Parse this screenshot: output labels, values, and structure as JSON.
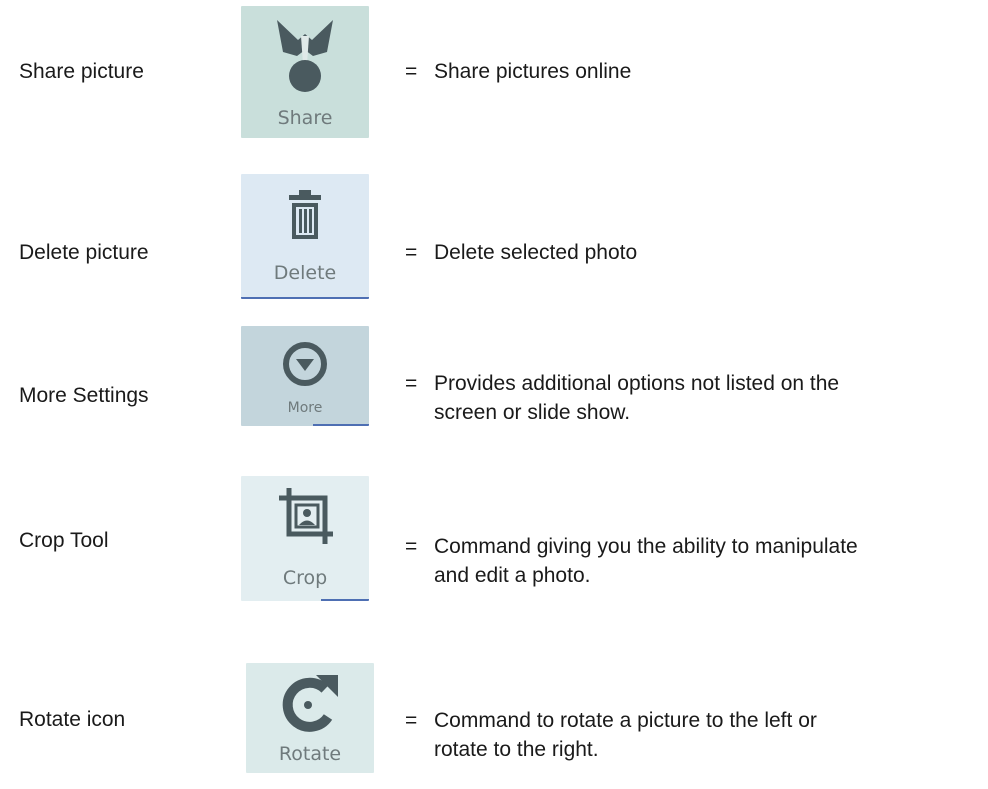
{
  "rows": [
    {
      "label": "Share picture",
      "icon": "share-icon",
      "caption": "Share",
      "equals": "=",
      "description": [
        "Share pictures online"
      ]
    },
    {
      "label": "Delete picture",
      "icon": "trash-icon",
      "caption": "Delete",
      "equals": "=",
      "description": [
        "Delete selected photo"
      ]
    },
    {
      "label": "More Settings",
      "icon": "more-icon",
      "caption": "More",
      "equals": "=",
      "description": [
        "Provides additional options not listed on the",
        "screen or slide show."
      ]
    },
    {
      "label": "Crop Tool",
      "icon": "crop-icon",
      "caption": "Crop",
      "equals": "=",
      "description": [
        "Command giving you the ability to manipulate",
        "and edit a photo."
      ]
    },
    {
      "label": "Rotate icon",
      "icon": "rotate-icon",
      "caption": "Rotate",
      "equals": "=",
      "description": [
        "Command to rotate a picture to the left or",
        "rotate to the right."
      ]
    }
  ],
  "colors": {
    "tile_share": "#c9dfdb",
    "tile_delete": "#dde9f3",
    "tile_more": "#c3d5dc",
    "tile_crop": "#e3eef1",
    "tile_rotate": "#dbeaea",
    "icon": "#4a5a5f",
    "accent_line": "#4e6fb3"
  }
}
